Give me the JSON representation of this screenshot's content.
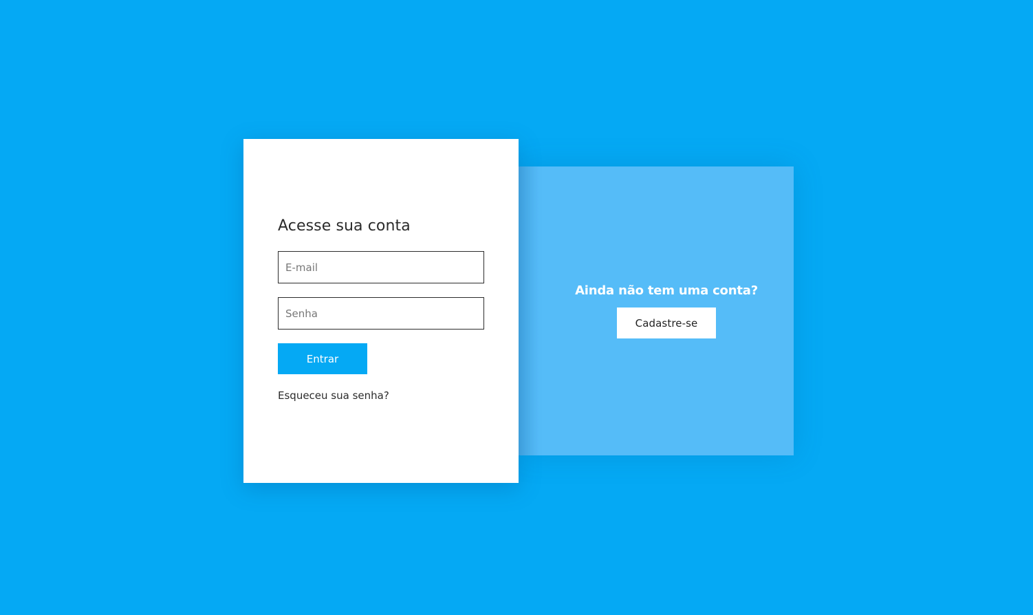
{
  "colors": {
    "background": "#05a9f4",
    "accent": "#05a9f4",
    "side_panel": "#55bcf8",
    "card": "#ffffff",
    "text": "#2b2b2b"
  },
  "login": {
    "title": "Acesse sua conta",
    "email_placeholder": "E-mail",
    "email_value": "",
    "password_placeholder": "Senha",
    "password_value": "",
    "submit_label": "Entrar",
    "forgot_label": "Esqueceu sua senha?"
  },
  "signup": {
    "question": "Ainda não tem uma conta?",
    "button_label": "Cadastre-se"
  }
}
